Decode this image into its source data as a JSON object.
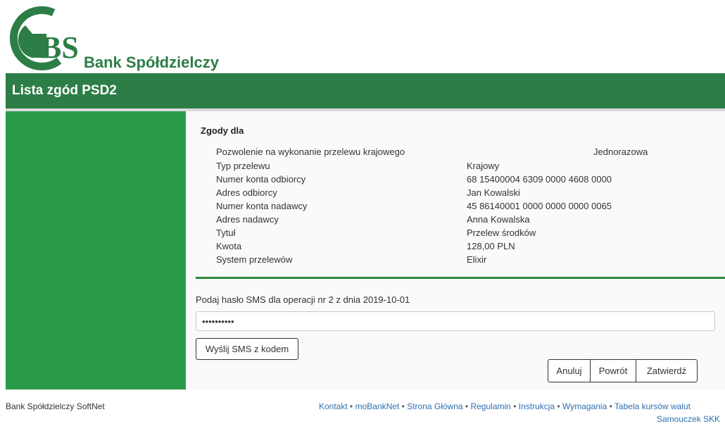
{
  "brand": {
    "logo_letters": "BS",
    "logo_text": "Bank Spółdzielczy",
    "green": "#2d7d46",
    "sidebar_green": "#2a9a49"
  },
  "header": {
    "title": "Lista zgód PSD2"
  },
  "consent": {
    "heading": "Zgody dla",
    "permission_label": "Pozwolenie na wykonanie przelewu krajowego",
    "permission_value": "Jednorazowa",
    "rows": [
      {
        "label": "Typ przelewu",
        "value": "Krajowy"
      },
      {
        "label": "Numer konta odbiorcy",
        "value": "68 15400004 6309 0000 4608 0000"
      },
      {
        "label": "Adres odbiorcy",
        "value": "Jan Kowalski"
      },
      {
        "label": "Numer konta nadawcy",
        "value": "45 86140001 0000 0000 0000 0065"
      },
      {
        "label": "Adres nadawcy",
        "value": "Anna Kowalska"
      },
      {
        "label": "Tytuł",
        "value": "Przelew środków"
      },
      {
        "label": "Kwota",
        "value": "128,00 PLN"
      },
      {
        "label": "System przelewów",
        "value": "Elixir"
      }
    ]
  },
  "sms": {
    "label": "Podaj hasło SMS dla operacji nr 2 z dnia 2019-10-01",
    "value": "••••••••••",
    "send_button": "Wyślij SMS z kodem"
  },
  "actions": {
    "cancel": "Anuluj",
    "back": "Powrót",
    "confirm": "Zatwierdź"
  },
  "footer": {
    "left": "Bank Spółdzielczy SoftNet",
    "links": [
      "Kontakt",
      "moBankNet",
      "Strona Główna",
      "Regulamin",
      "Instrukcja",
      "Wymagania",
      "Tabela kursów walut"
    ],
    "link_row2": "Samouczek SKK",
    "separator": "•"
  }
}
